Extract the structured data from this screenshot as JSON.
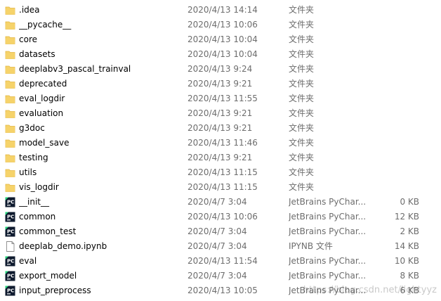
{
  "colors": {
    "folder": "#f6d36a",
    "folder_dark": "#e3b743",
    "pycharm_bg": "#0e1a2e",
    "pycharm_accent": "#27d07a",
    "hover": "#e5f3ff"
  },
  "files": [
    {
      "name": ".idea",
      "date": "2020/4/13 14:14",
      "type": "文件夹",
      "size": "",
      "icon": "folder-icon"
    },
    {
      "name": "__pycache__",
      "date": "2020/4/13 10:06",
      "type": "文件夹",
      "size": "",
      "icon": "folder-icon"
    },
    {
      "name": "core",
      "date": "2020/4/13 10:04",
      "type": "文件夹",
      "size": "",
      "icon": "folder-icon"
    },
    {
      "name": "datasets",
      "date": "2020/4/13 10:04",
      "type": "文件夹",
      "size": "",
      "icon": "folder-icon"
    },
    {
      "name": "deeplabv3_pascal_trainval",
      "date": "2020/4/13 9:24",
      "type": "文件夹",
      "size": "",
      "icon": "folder-icon"
    },
    {
      "name": "deprecated",
      "date": "2020/4/13 9:21",
      "type": "文件夹",
      "size": "",
      "icon": "folder-icon"
    },
    {
      "name": "eval_logdir",
      "date": "2020/4/13 11:55",
      "type": "文件夹",
      "size": "",
      "icon": "folder-icon"
    },
    {
      "name": "evaluation",
      "date": "2020/4/13 9:21",
      "type": "文件夹",
      "size": "",
      "icon": "folder-icon"
    },
    {
      "name": "g3doc",
      "date": "2020/4/13 9:21",
      "type": "文件夹",
      "size": "",
      "icon": "folder-icon"
    },
    {
      "name": "model_save",
      "date": "2020/4/13 11:46",
      "type": "文件夹",
      "size": "",
      "icon": "folder-icon"
    },
    {
      "name": "testing",
      "date": "2020/4/13 9:21",
      "type": "文件夹",
      "size": "",
      "icon": "folder-icon"
    },
    {
      "name": "utils",
      "date": "2020/4/13 11:15",
      "type": "文件夹",
      "size": "",
      "icon": "folder-icon"
    },
    {
      "name": "vis_logdir",
      "date": "2020/4/13 11:15",
      "type": "文件夹",
      "size": "",
      "icon": "folder-icon"
    },
    {
      "name": "__init__",
      "date": "2020/4/7 3:04",
      "type": "JetBrains PyChar...",
      "size": "0 KB",
      "icon": "pycharm-file-icon"
    },
    {
      "name": "common",
      "date": "2020/4/13 10:06",
      "type": "JetBrains PyChar...",
      "size": "12 KB",
      "icon": "pycharm-file-icon"
    },
    {
      "name": "common_test",
      "date": "2020/4/7 3:04",
      "type": "JetBrains PyChar...",
      "size": "2 KB",
      "icon": "pycharm-file-icon"
    },
    {
      "name": "deeplab_demo.ipynb",
      "date": "2020/4/7 3:04",
      "type": "IPYNB 文件",
      "size": "14 KB",
      "icon": "blank-file-icon"
    },
    {
      "name": "eval",
      "date": "2020/4/13 11:54",
      "type": "JetBrains PyChar...",
      "size": "10 KB",
      "icon": "pycharm-file-icon"
    },
    {
      "name": "export_model",
      "date": "2020/4/7 3:04",
      "type": "JetBrains PyChar...",
      "size": "8 KB",
      "icon": "pycharm-file-icon"
    },
    {
      "name": "input_preprocess",
      "date": "2020/4/13 10:05",
      "type": "JetBrains PyChar...",
      "size": "6 KB",
      "icon": "pycharm-file-icon"
    }
  ],
  "watermark": "https://blog.csdn.net/lightyyz"
}
